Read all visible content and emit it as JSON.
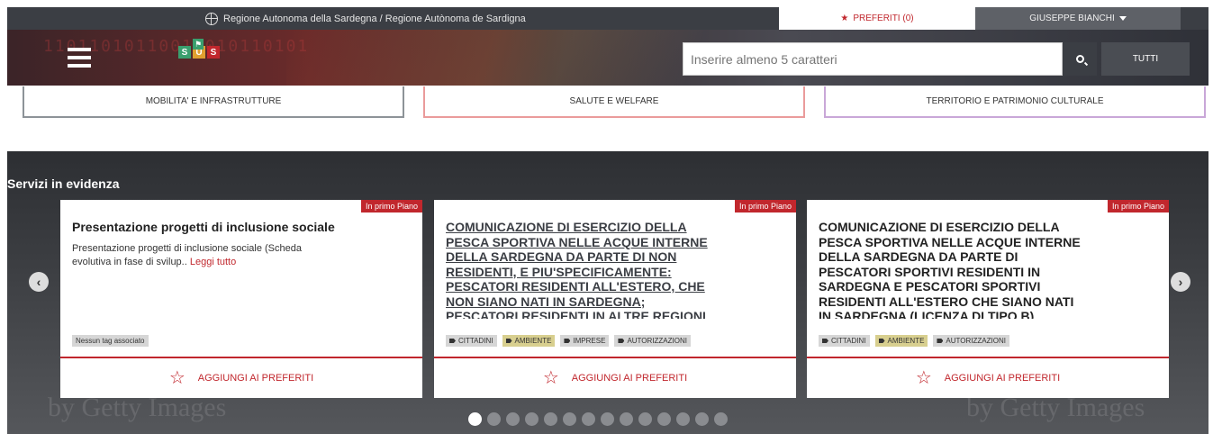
{
  "topbar": {
    "region": "Regione Autonoma della Sardegna / Regione Autònoma de Sardigna",
    "favorites": "PREFERITI (0)",
    "user": "GIUSEPPE BIANCHI"
  },
  "header": {
    "binary_text": "11011010110011010110101",
    "logo_letters": [
      "S",
      "U",
      "S"
    ],
    "logo_colors": [
      "#3a9f6e",
      "#e0a030",
      "#c1272d"
    ],
    "search": {
      "placeholder": "Inserire almeno 5 caratteri",
      "value": ""
    },
    "all_label": "TUTTI"
  },
  "categories": [
    {
      "label": "MOBILITA' E INFRASTRUTTURE",
      "color": "#8d9398"
    },
    {
      "label": "SALUTE E WELFARE",
      "color": "#ea9b9b"
    },
    {
      "label": "TERRITORIO E PATRIMONIO CULTURALE",
      "color": "#c9a7d8"
    }
  ],
  "featured": {
    "title": "Servizi in evidenza",
    "watermark": "by Getty Images",
    "cards": [
      {
        "badge": "In primo Piano",
        "title": "Presentazione progetti di inclusione sociale",
        "description": "Presentazione progetti di inclusione sociale (Scheda evolutiva in fase di svilup..",
        "read_more": "Leggi tutto",
        "tags": [
          "Nessun tag associato"
        ],
        "favorite": "AGGIUNGI AI PREFERITI"
      },
      {
        "badge": "In primo Piano",
        "title": "COMUNICAZIONE DI ESERCIZIO DELLA PESCA SPORTIVA NELLE ACQUE INTERNE DELLA SARDEGNA DA PARTE DI NON RESIDENTI, E PIU'SPECIFICAMENTE: PESCATORI RESIDENTI ALL'ESTERO, CHE NON SIANO NATI IN SARDEGNA; PESCATORI RESIDENTI IN ALTRE REGIONI",
        "tags": [
          "CITTADINI",
          "AMBIENTE",
          "IMPRESE",
          "AUTORIZZAZIONI"
        ],
        "favorite": "AGGIUNGI AI PREFERITI"
      },
      {
        "badge": "In primo Piano",
        "title": "COMUNICAZIONE DI ESERCIZIO DELLA PESCA SPORTIVA NELLE ACQUE INTERNE DELLA SARDEGNA DA PARTE DI PESCATORI SPORTIVI RESIDENTI IN SARDEGNA E PESCATORI SPORTIVI RESIDENTI ALL'ESTERO CHE SIANO NATI IN SARDEGNA (LICENZA DI TIPO B)",
        "tags": [
          "CITTADINI",
          "AMBIENTE",
          "AUTORIZZAZIONI"
        ],
        "favorite": "AGGIUNGI AI PREFERITI"
      }
    ],
    "pager": {
      "total": 14,
      "active": 1
    }
  }
}
